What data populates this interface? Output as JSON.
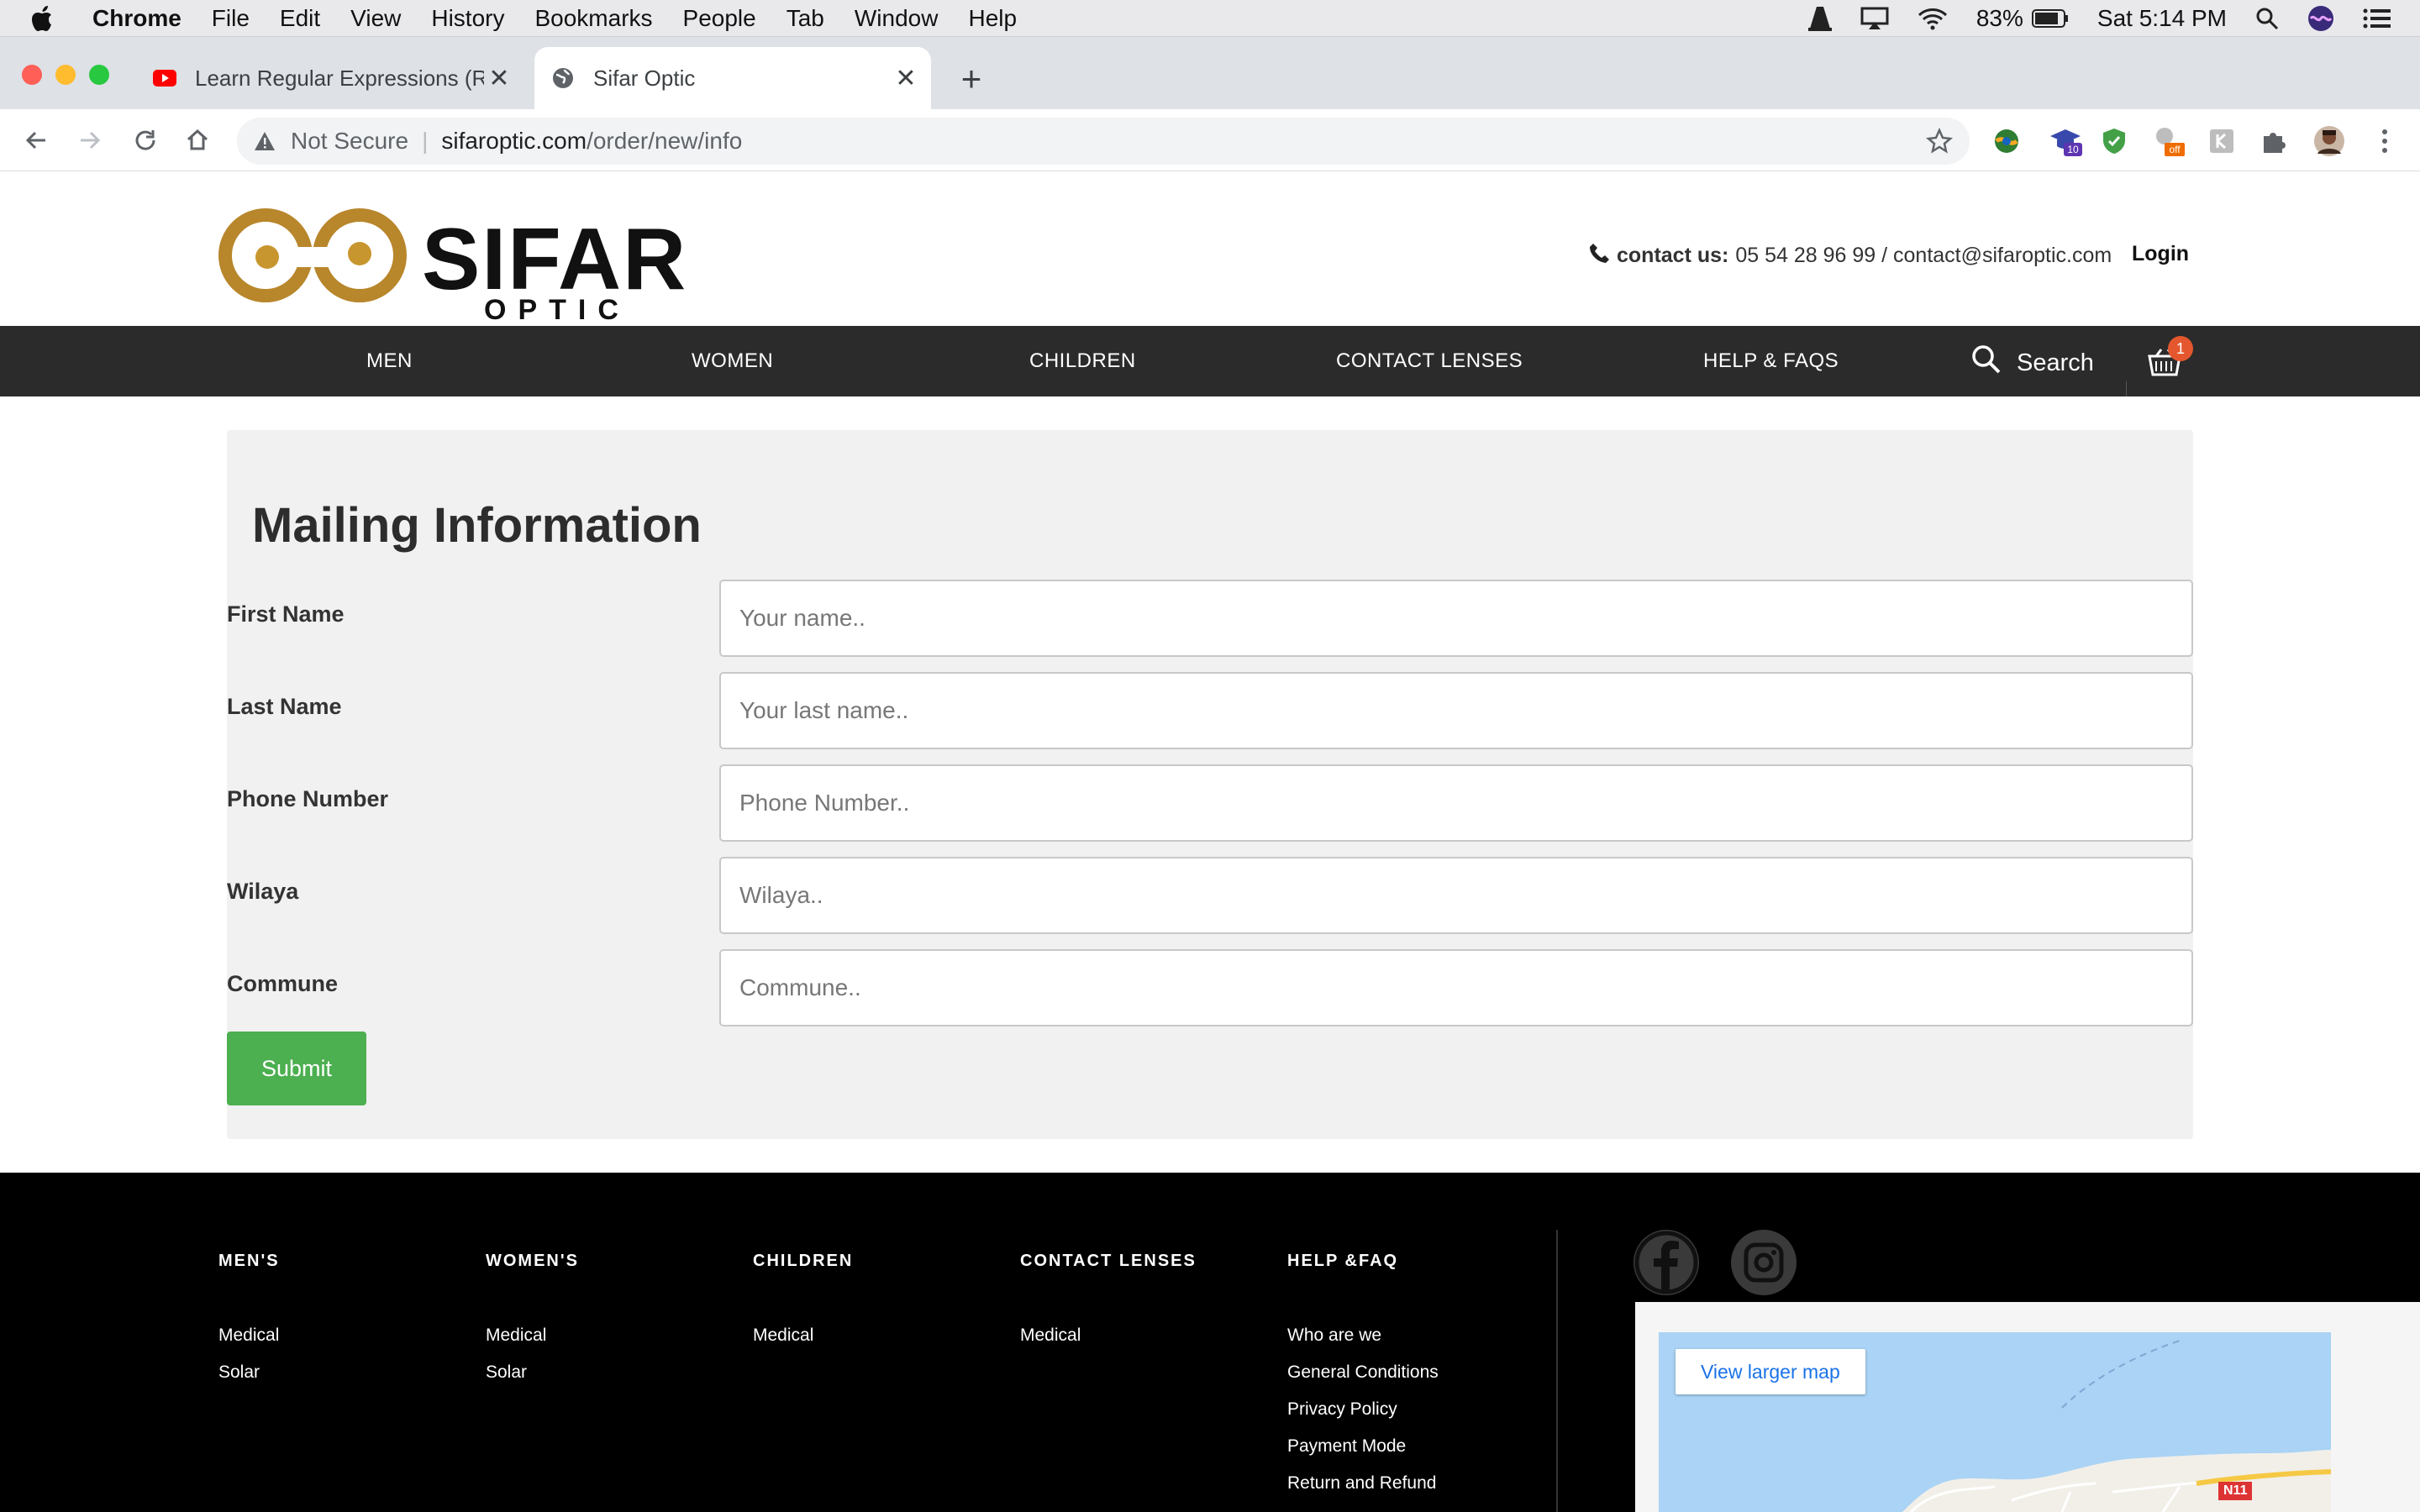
{
  "menubar": {
    "app": "Chrome",
    "items": [
      "File",
      "Edit",
      "View",
      "History",
      "Bookmarks",
      "People",
      "Tab",
      "Window",
      "Help"
    ],
    "battery": "83%",
    "clock": "Sat 5:14 PM"
  },
  "tabs": [
    {
      "title": "Learn Regular Expressions (Re",
      "icon": "youtube-icon"
    },
    {
      "title": "Sifar Optic",
      "icon": "globe-icon"
    }
  ],
  "omnibox": {
    "security": "Not Secure",
    "host": "sifaroptic.com",
    "path": "/order/new/info"
  },
  "extensions": {
    "badge_count": "10",
    "badge_off": "off"
  },
  "header": {
    "logo_text": "SIFAR",
    "logo_sub": "OPTIC",
    "contact_label": "contact us:",
    "contact_value": "05 54 28 96 99 / contact@sifaroptic.com",
    "login": "Login"
  },
  "nav": {
    "items": [
      "MEN",
      "WOMEN",
      "CHILDREN",
      "CONTACT LENSES",
      "HELP & FAQS"
    ],
    "search": "Search",
    "cart_count": "1"
  },
  "form": {
    "title": "Mailing Information",
    "fields": [
      {
        "label": "First Name",
        "placeholder": "Your name..",
        "value": ""
      },
      {
        "label": "Last Name",
        "placeholder": "Your last name..",
        "value": ""
      },
      {
        "label": "Phone Number",
        "placeholder": "Phone Number..",
        "value": ""
      },
      {
        "label": "Wilaya",
        "placeholder": "Wilaya..",
        "value": ""
      },
      {
        "label": "Commune",
        "placeholder": "Commune..",
        "value": ""
      }
    ],
    "submit": "Submit"
  },
  "footer": {
    "columns": [
      {
        "title": "MEN'S",
        "links": [
          "Medical",
          "Solar"
        ]
      },
      {
        "title": "WOMEN'S",
        "links": [
          "Medical",
          "Solar"
        ]
      },
      {
        "title": "CHILDREN",
        "links": [
          "Medical"
        ]
      },
      {
        "title": "CONTACT LENSES",
        "links": [
          "Medical"
        ]
      },
      {
        "title": "HELP &FAQ",
        "links": [
          "Who are we",
          "General Conditions",
          "Privacy Policy",
          "Payment Mode",
          "Return and Refund"
        ]
      }
    ],
    "map_button": "View larger map",
    "map_road": "N11"
  },
  "colors": {
    "nav_bg": "#2b2b2b",
    "submit_green": "#4caf50",
    "logo_gold": "#b8862b",
    "badge_orange": "#e4572e"
  }
}
